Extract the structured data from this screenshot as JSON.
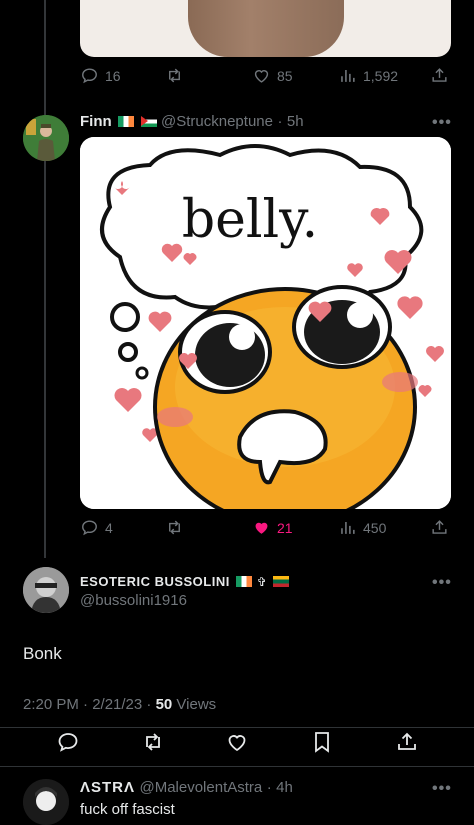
{
  "tweet_prev": {
    "stats": {
      "replies": "16",
      "likes": "85",
      "views": "1,592"
    }
  },
  "tweet_finn": {
    "display_name": "Finn",
    "handle": "@Struckneptune",
    "separator": "·",
    "time": "5h",
    "meme_text": "belly.",
    "stats": {
      "replies": "4",
      "likes": "21",
      "views": "450"
    },
    "liked": true
  },
  "tweet_main": {
    "display_name": "ESOTERIC BUSSOLINI",
    "handle": "@bussolini1916",
    "body": "Bonk",
    "timestamp": "2:20 PM · 2/21/23 · ",
    "views_count": "50",
    "views_label": " Views"
  },
  "tweet_reply": {
    "display_name": "ΛSTRΛ",
    "handle": "@MalevolentAstra",
    "separator": "·",
    "time": "4h",
    "body": "fuck off fascist"
  },
  "colors": {
    "like_pink": "#f91880",
    "muted": "#71767b",
    "text": "#e7e9ea"
  },
  "icons": [
    "reply-icon",
    "retweet-icon",
    "like-icon",
    "views-icon",
    "share-icon",
    "more-icon",
    "bookmark-icon"
  ]
}
